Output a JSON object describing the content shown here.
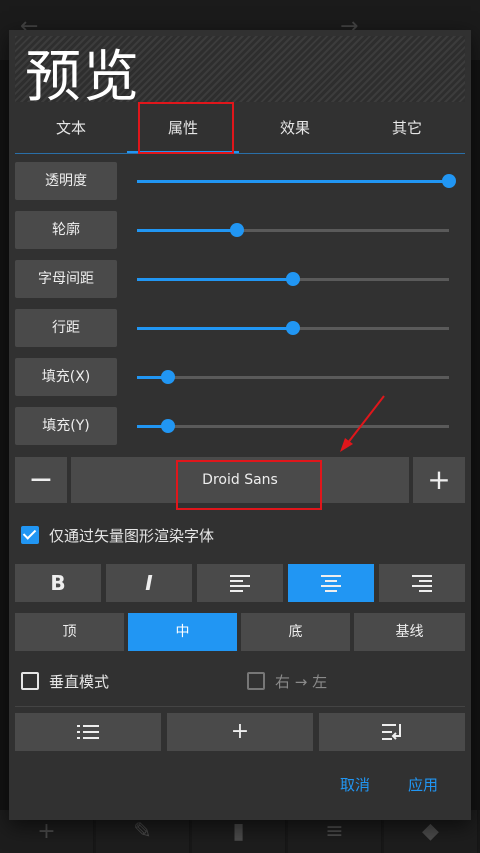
{
  "preview": {
    "text": "预览"
  },
  "tabs": [
    {
      "label": "文本"
    },
    {
      "label": "属性"
    },
    {
      "label": "效果"
    },
    {
      "label": "其它"
    }
  ],
  "properties": [
    {
      "label": "透明度",
      "value": 1.0
    },
    {
      "label": "轮廓",
      "value": 0.32
    },
    {
      "label": "字母间距",
      "value": 0.5
    },
    {
      "label": "行距",
      "value": 0.5
    },
    {
      "label": "填充(X)",
      "value": 0.1
    },
    {
      "label": "填充(Y)",
      "value": 0.1
    }
  ],
  "font": {
    "minus": "−",
    "name": "Droid Sans",
    "plus": "+"
  },
  "vector_render": {
    "label": "仅通过矢量图形渲染字体",
    "checked": true
  },
  "format": {
    "bold": "B",
    "italic": "I"
  },
  "valign": [
    {
      "label": "顶"
    },
    {
      "label": "中"
    },
    {
      "label": "底"
    },
    {
      "label": "基线"
    }
  ],
  "vertical_mode": {
    "label": "垂直模式",
    "checked": false
  },
  "rtl": {
    "label": "右 → 左",
    "checked": false
  },
  "tools": {
    "add": "+"
  },
  "footer": {
    "cancel": "取消",
    "apply": "应用"
  },
  "colors": {
    "accent": "#2196f3",
    "annotation": "#e0161b"
  }
}
